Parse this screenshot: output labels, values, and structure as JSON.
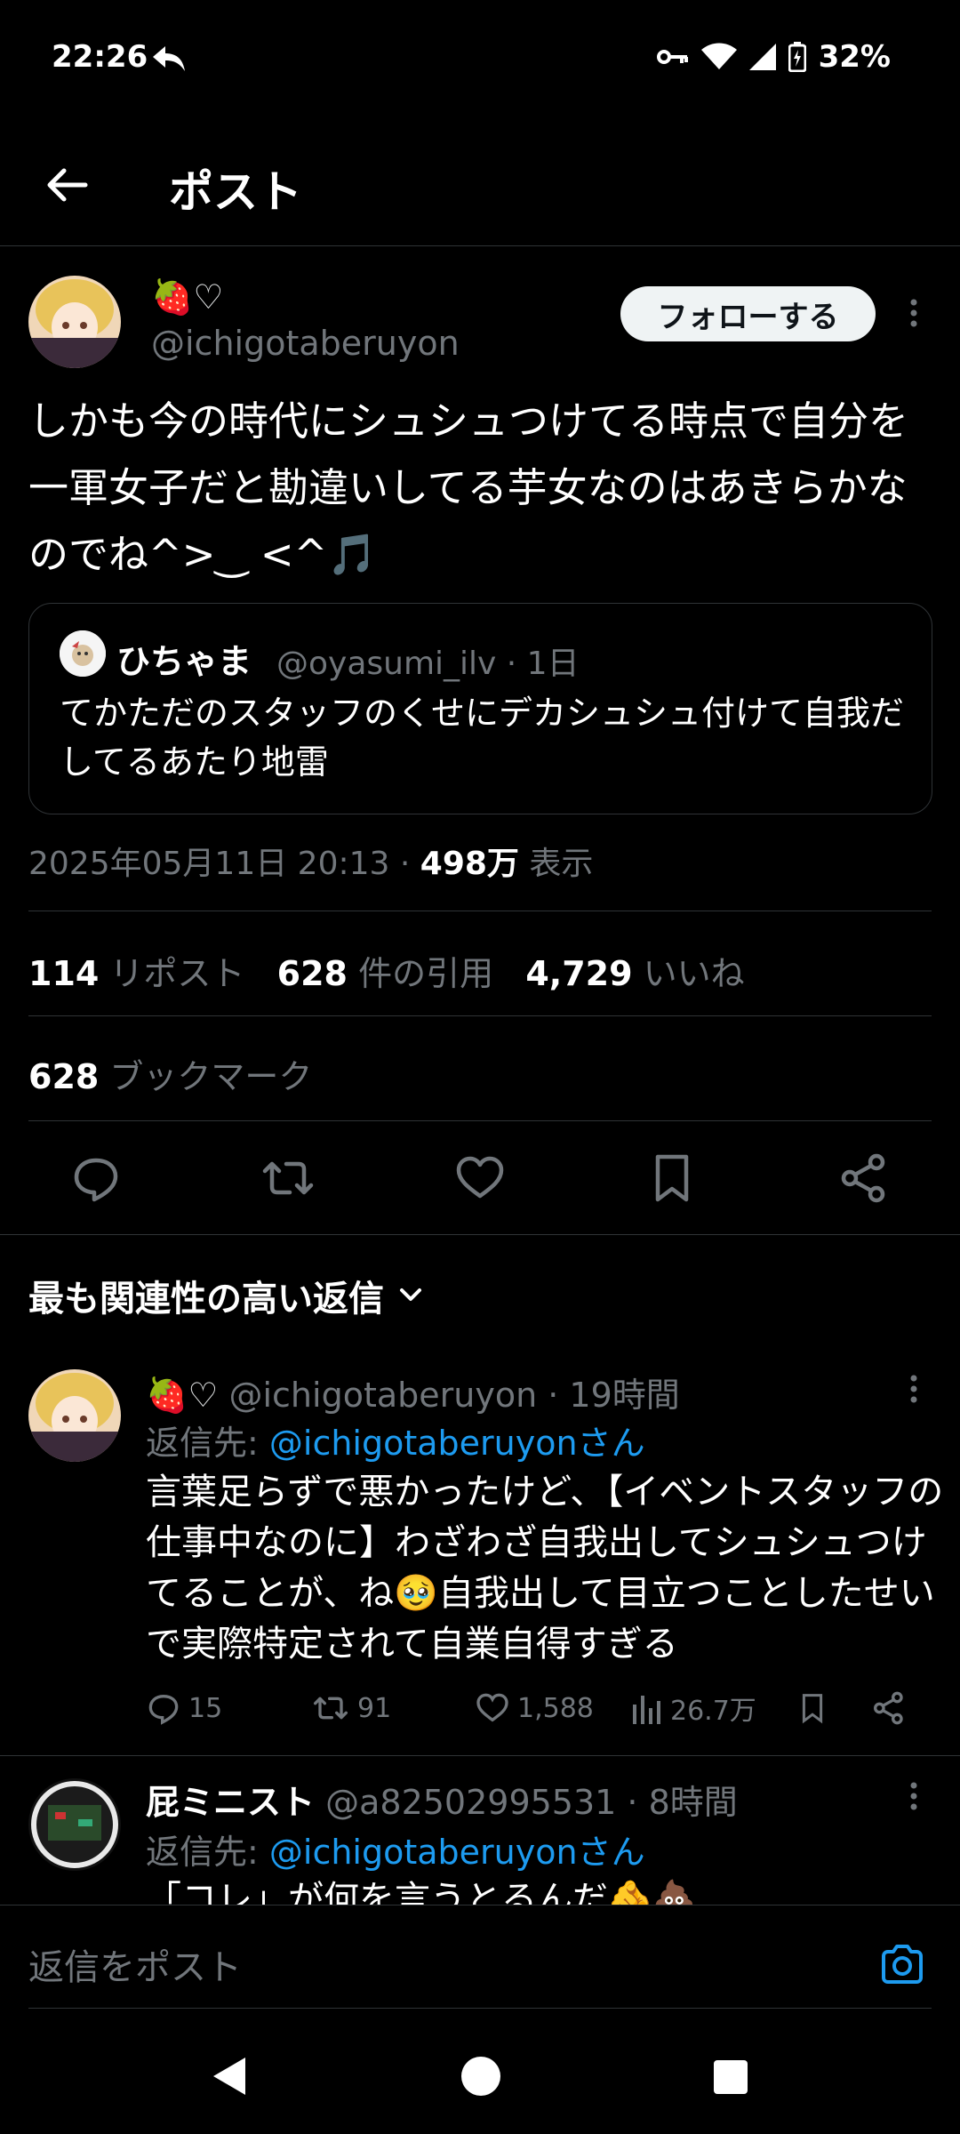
{
  "status_bar": {
    "time": "22:26",
    "battery": "32%"
  },
  "header": {
    "title": "ポスト"
  },
  "post": {
    "author_name": "🍓♡",
    "author_handle": "@ichigotaberuyon",
    "follow_label": "フォローする",
    "text": "しかも今の時代にシュシュつけてる時点で自分を一軍女子だと勘違いしてる芋女なのはあきらかなのでね^>‿ <^🎵",
    "quote": {
      "name": "ひちゃま",
      "meta": "@oyasumi_ilv · 1日",
      "text": "てかただのスタッフのくせにデカシュシュ付けて自我だしてるあたり地雷"
    },
    "date": "2025年05月11日 20:13 · ",
    "views": "498万",
    "views_label": " 表示",
    "stats": {
      "reposts": "114",
      "reposts_label": " リポスト",
      "quotes": "628",
      "quotes_label": " 件の引用",
      "likes": "4,729",
      "likes_label": " いいね",
      "bookmarks": "628",
      "bookmarks_label": " ブックマーク"
    }
  },
  "replies_header": {
    "label": "最も関連性の高い返信"
  },
  "replies": [
    {
      "name": "🍓♡",
      "meta": "@ichigotaberuyon · 19時間",
      "reply_to_prefix": "返信先: ",
      "reply_to": "@ichigotaberuyonさん",
      "text": "言葉足らずで悪かったけど、【イベントスタッフの仕事中なのに】わざわざ自我出してシュシュつけてることが、ね🥹自我出して目立つことしたせいで実際特定されて自業自得すぎる",
      "replies": "15",
      "reposts": "91",
      "likes": "1,588",
      "views": "26.7万"
    },
    {
      "name": "屁ミニスト",
      "meta": "@a82502995531 · 8時間",
      "reply_to_prefix": "返信先: ",
      "reply_to": "@ichigotaberuyonさん",
      "text": "「コレ」が何を言うとるんだ🫵💩"
    }
  ],
  "composer": {
    "placeholder": "返信をポスト"
  },
  "colors": {
    "accent": "#1d9bf0",
    "background": "#000000",
    "muted": "#71767b"
  }
}
